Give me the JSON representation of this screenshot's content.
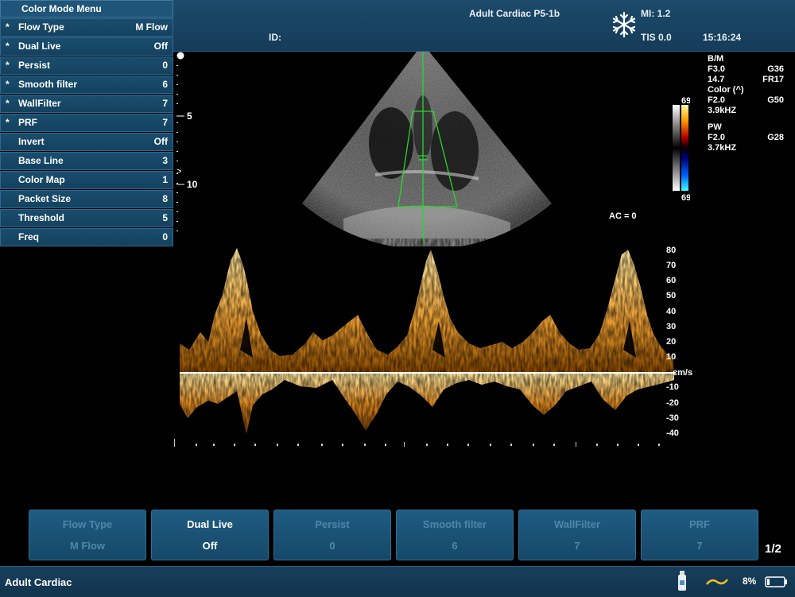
{
  "header": {
    "mode_probe": "Adult  Cardiac  P5-1b",
    "id_label": "ID:",
    "mi": "MI:  1.2",
    "tis": "TIS  0.0",
    "time": "15:16:24",
    "freeze_icon": "snowflake-icon"
  },
  "menu": {
    "title": "Color  Mode  Menu",
    "items": [
      {
        "star": "*",
        "label": "Flow  Type",
        "value": "M  Flow"
      },
      {
        "star": "*",
        "label": "Dual  Live",
        "value": "Off"
      },
      {
        "star": "*",
        "label": "Persist",
        "value": "0"
      },
      {
        "star": "*",
        "label": "Smooth  filter",
        "value": "6"
      },
      {
        "star": "*",
        "label": "WallFilter",
        "value": "7"
      },
      {
        "star": "*",
        "label": "PRF",
        "value": "7"
      },
      {
        "star": "",
        "label": "Invert",
        "value": "Off"
      },
      {
        "star": "",
        "label": "Base  Line",
        "value": "3"
      },
      {
        "star": "",
        "label": "Color  Map",
        "value": "1"
      },
      {
        "star": "",
        "label": "Packet  Size",
        "value": "8"
      },
      {
        "star": "",
        "label": "Threshold",
        "value": "5"
      },
      {
        "star": "",
        "label": "Freq",
        "value": "0"
      }
    ]
  },
  "depth": {
    "mark_5": "5",
    "mark_10": "10",
    "focus": ">"
  },
  "params": {
    "bm": "B/M",
    "bm_freq": "F3.0",
    "bm_gain": "G36",
    "bm_depth": "14.7",
    "bm_fr": "FR17",
    "color": "Color  (^)",
    "color_freq": "F2.0",
    "color_gain": "G50",
    "color_prf": "3.9kHZ",
    "pw": "PW",
    "pw_freq": "F2.0",
    "pw_gain": "G28",
    "pw_prf": "3.7kHZ"
  },
  "colorbar": {
    "top": "69",
    "bottom": "69"
  },
  "ac": "AC  =  0",
  "velocity_scale": {
    "ticks": [
      "80",
      "70",
      "60",
      "50",
      "40",
      "30",
      "20",
      "10"
    ],
    "unit": "cm/s",
    "neg_ticks": [
      "-10",
      "-20",
      "-30",
      "-40"
    ]
  },
  "softkeys": [
    {
      "label": "Flow  Type",
      "value": "M  Flow",
      "active": false
    },
    {
      "label": "Dual  Live",
      "value": "Off",
      "active": true
    },
    {
      "label": "Persist",
      "value": "0",
      "active": false
    },
    {
      "label": "Smooth  filter",
      "value": "6",
      "active": false
    },
    {
      "label": "WallFilter",
      "value": "7",
      "active": false
    },
    {
      "label": "PRF",
      "value": "7",
      "active": false
    }
  ],
  "page_indicator": "1/2",
  "status": {
    "exam": "Adult  Cardiac",
    "battery": "8%",
    "icons": [
      "bottle-icon",
      "wave-icon",
      "battery-icon"
    ]
  }
}
